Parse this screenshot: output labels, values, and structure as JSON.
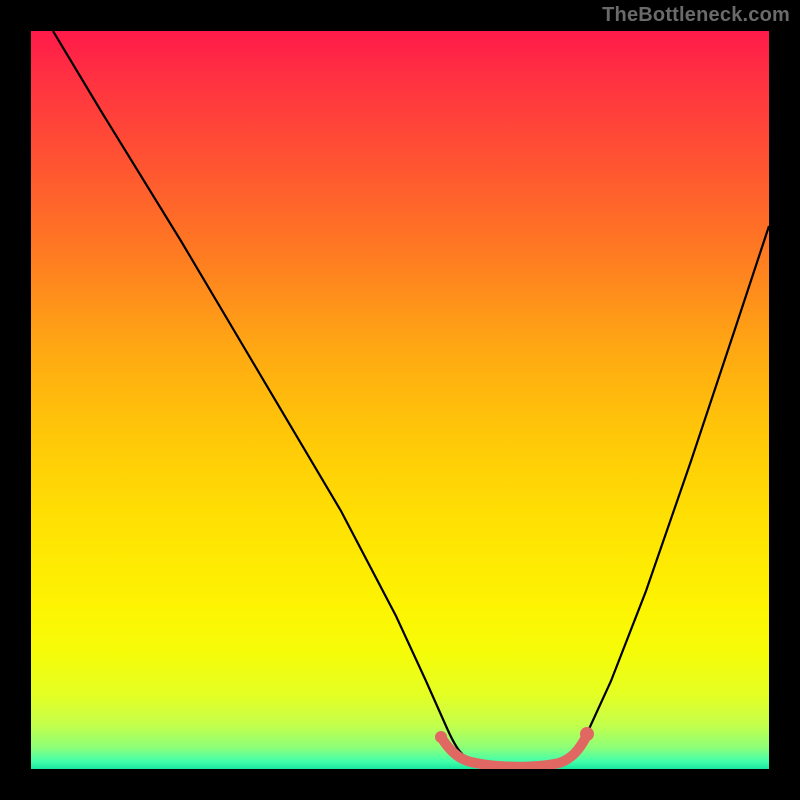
{
  "watermark": "TheBottleneck.com",
  "chart_data": {
    "type": "line",
    "title": "",
    "xlabel": "",
    "ylabel": "",
    "xlim": [
      0,
      100
    ],
    "ylim": [
      0,
      100
    ],
    "series": [
      {
        "name": "bottleneck-curve",
        "x": [
          3,
          10,
          20,
          30,
          40,
          48,
          52,
          55,
          58,
          62,
          66,
          70,
          75,
          80,
          85,
          90,
          95,
          100
        ],
        "y": [
          100,
          85,
          68,
          50,
          33,
          18,
          10,
          4,
          1,
          0,
          0,
          1,
          5,
          13,
          24,
          37,
          51,
          66
        ]
      }
    ],
    "flat_region_x": [
      57,
      71
    ],
    "gradient_stops": [
      {
        "pos": 0,
        "color": "#ff1a49"
      },
      {
        "pos": 50,
        "color": "#ffc808"
      },
      {
        "pos": 85,
        "color": "#f6fc08"
      },
      {
        "pos": 100,
        "color": "#18e69e"
      }
    ],
    "highlight_color": "#e06762"
  }
}
